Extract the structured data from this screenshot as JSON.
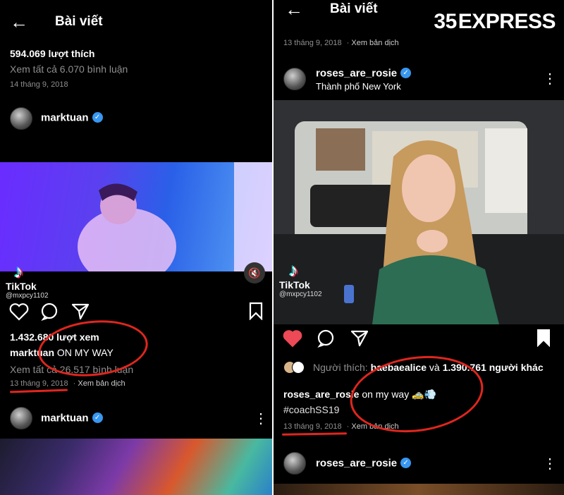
{
  "left": {
    "header": {
      "back_icon": "back-arrow-icon",
      "title": "Bài viết"
    },
    "prev_post": {
      "likes": "594.069 lượt thích",
      "view_comments": "Xem tất cả 6.070 bình luận",
      "date": "14 tháng 9, 2018"
    },
    "post": {
      "username": "marktuan",
      "tiktok": {
        "brand": "TikTok",
        "user": "@mxpcy1102"
      },
      "views": "1.432.680 lượt xem",
      "caption_user": "marktuan",
      "caption_text": "ON MY WAY",
      "view_comments": "Xem tất cả 26.517 bình luận",
      "date": "13 tháng 9, 2018",
      "see_translation": "Xem bản dịch"
    },
    "next_post": {
      "username": "marktuan"
    }
  },
  "right": {
    "header": {
      "back_icon": "back-arrow-icon",
      "title": "Bài viết"
    },
    "prev_post": {
      "date": "13 tháng 9, 2018",
      "see_translation": "Xem bản dịch"
    },
    "post": {
      "username": "roses_are_rosie",
      "location": "Thành phố New York",
      "tiktok": {
        "brand": "TikTok",
        "user": "@mxpcy1102"
      },
      "liked_by_prefix": "Người thích:",
      "liked_by_user": "baebaealice",
      "liked_by_and": "và",
      "liked_by_others": "1.390.761 người khác",
      "caption_user": "roses_are_rosie",
      "caption_text": "on my way",
      "caption_emoji": "🚕💨",
      "hashtag": "#coachSS19",
      "date": "13 tháng 9, 2018",
      "see_translation": "Xem bản dịch"
    },
    "next_post": {
      "username": "roses_are_rosie"
    }
  },
  "watermark": {
    "text": "EXPRESS",
    "mark": "35"
  },
  "colors": {
    "background": "#000000",
    "muted": "#8e8e8e",
    "verified": "#3897f0",
    "heart": "#ed4956",
    "annotation": "#e0261e"
  }
}
